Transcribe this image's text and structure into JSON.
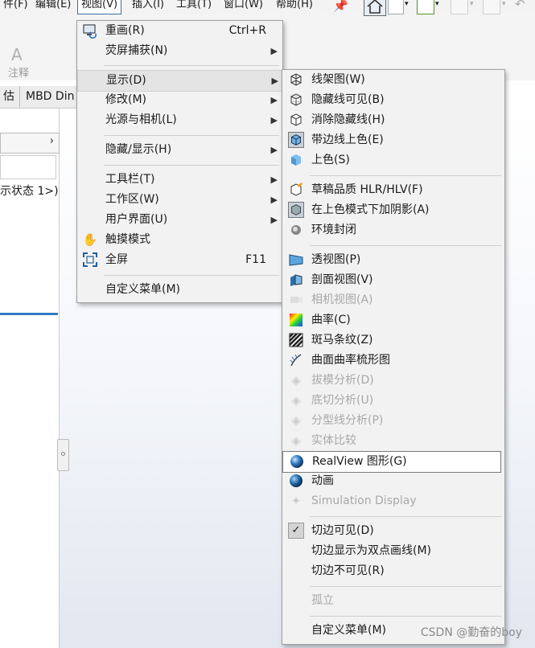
{
  "menubar": {
    "items": [
      "件(F)",
      "编辑(E)",
      "视图(V)",
      "插入(I)",
      "工具(T)",
      "窗口(W)",
      "帮助(H)"
    ],
    "active": "视图(V)"
  },
  "toolbar": {
    "annotation_label": "注释"
  },
  "tabs": [
    "估",
    "MBD Din"
  ],
  "left_panel": {
    "config_state": "示状态 1>)"
  },
  "view_menu": {
    "items": [
      {
        "label": "重画(R)",
        "shortcut": "Ctrl+R",
        "icon": "redraw-icon"
      },
      {
        "label": "荧屏捕获(N)",
        "submenu": true
      },
      {
        "label": "显示(D)",
        "submenu": true,
        "highlighted": true
      },
      {
        "label": "修改(M)",
        "submenu": true
      },
      {
        "label": "光源与相机(L)",
        "submenu": true
      },
      {
        "label": "隐藏/显示(H)",
        "submenu": true
      },
      {
        "label": "工具栏(T)",
        "submenu": true
      },
      {
        "label": "工作区(W)",
        "submenu": true
      },
      {
        "label": "用户界面(U)",
        "submenu": true
      },
      {
        "label": "触摸模式",
        "icon": "touch-hand-icon"
      },
      {
        "label": "全屏",
        "shortcut": "F11",
        "icon": "fullscreen-icon"
      },
      {
        "label": "自定义菜单(M)"
      }
    ]
  },
  "display_menu": {
    "items": [
      {
        "label": "线架图(W)",
        "icon": "wireframe-icon"
      },
      {
        "label": "隐藏线可见(B)",
        "icon": "hidden-lines-visible-icon"
      },
      {
        "label": "消除隐藏线(H)",
        "icon": "hidden-lines-removed-icon"
      },
      {
        "label": "带边线上色(E)",
        "icon": "shaded-with-edges-icon"
      },
      {
        "label": "上色(S)",
        "icon": "shaded-icon"
      },
      {
        "label": "草稿品质 HLR/HLV(F)",
        "icon": "draft-quality-icon"
      },
      {
        "label": "在上色模式下加阴影(A)",
        "icon": "shadows-in-shaded-icon"
      },
      {
        "label": "环境封闭",
        "icon": "ambient-occlusion-icon"
      },
      {
        "label": "透视图(P)",
        "icon": "perspective-icon"
      },
      {
        "label": "剖面视图(V)",
        "icon": "section-view-icon"
      },
      {
        "label": "相机视图(A)",
        "icon": "camera-view-icon",
        "disabled": true
      },
      {
        "label": "曲率(C)",
        "icon": "curvature-icon"
      },
      {
        "label": "斑马条纹(Z)",
        "icon": "zebra-stripes-icon"
      },
      {
        "label": "曲面曲率梳形图",
        "icon": "curvature-comb-icon"
      },
      {
        "label": "拔模分析(D)",
        "icon": "draft-analysis-icon",
        "disabled": true
      },
      {
        "label": "底切分析(U)",
        "icon": "undercut-analysis-icon",
        "disabled": true
      },
      {
        "label": "分型线分析(P)",
        "icon": "parting-line-analysis-icon",
        "disabled": true
      },
      {
        "label": "实体比较",
        "icon": "body-compare-icon",
        "disabled": true
      },
      {
        "label": "RealView 图形(G)",
        "icon": "realview-icon",
        "hovered": true
      },
      {
        "label": "动画",
        "icon": "animation-icon"
      },
      {
        "label": "Simulation Display",
        "icon": "simulation-display-icon",
        "disabled": true
      },
      {
        "label": "切边可见(D)",
        "icon": "check-icon",
        "checked": true
      },
      {
        "label": "切边显示为双点画线(M)"
      },
      {
        "label": "切边不可见(R)"
      },
      {
        "label": "孤立",
        "disabled": true
      },
      {
        "label": "自定义菜单(M)"
      }
    ]
  },
  "watermark": "CSDN @勤奋的boy",
  "colors": {
    "accent": "#2f7bc2",
    "menu_bg": "#f2f2f2",
    "highlight": "#e4e4e4"
  }
}
